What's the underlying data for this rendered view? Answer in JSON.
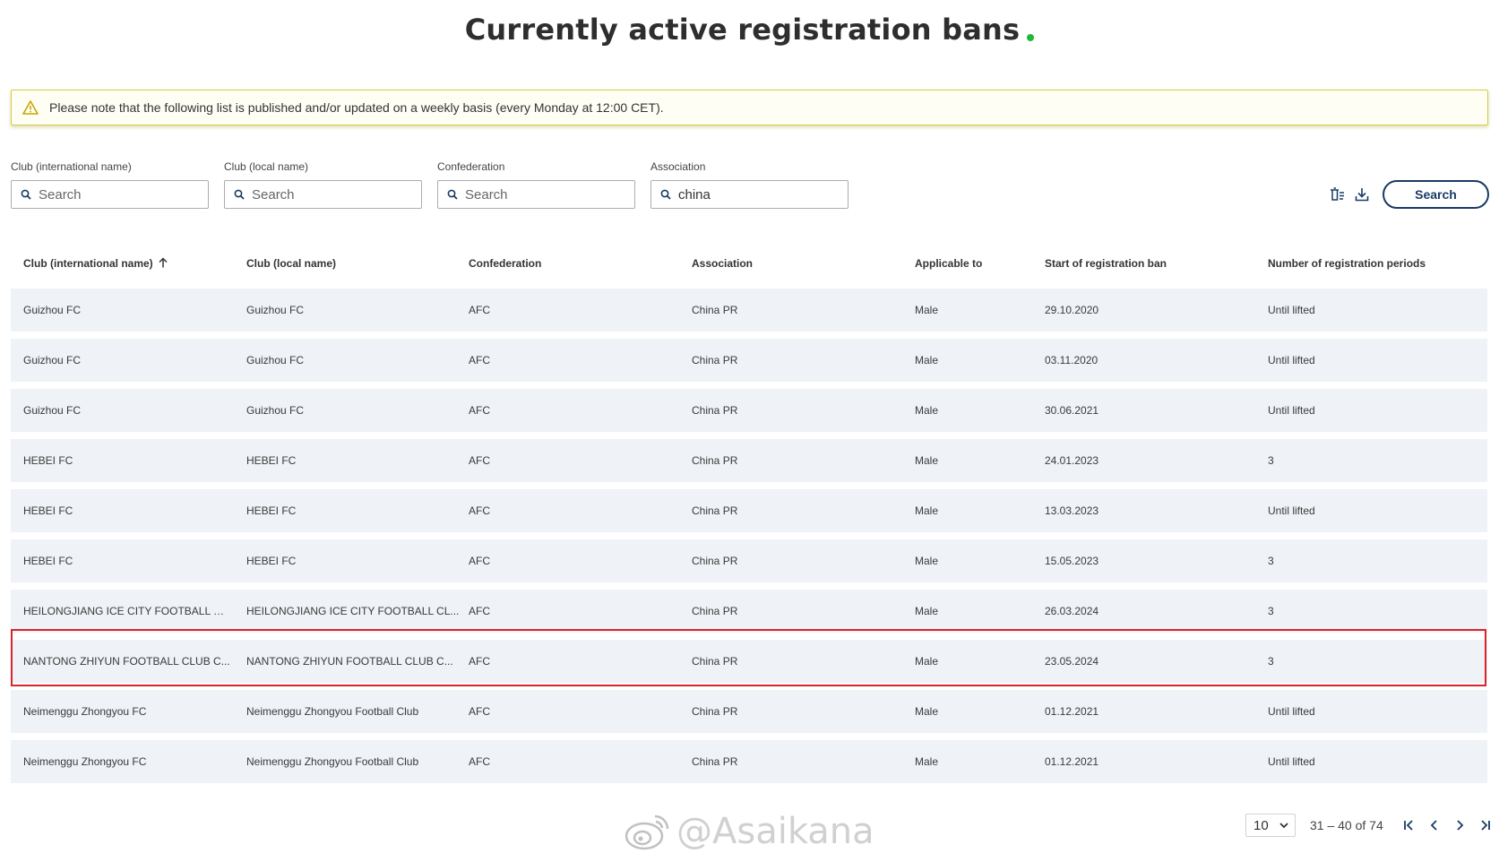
{
  "title": "Currently active registration bans",
  "notice": "Please note that the following list is published and/or updated on a weekly basis (every Monday at 12:00 CET).",
  "filters": [
    {
      "label": "Club (international name)",
      "placeholder": "Search",
      "value": ""
    },
    {
      "label": "Club (local name)",
      "placeholder": "Search",
      "value": ""
    },
    {
      "label": "Confederation",
      "placeholder": "Search",
      "value": ""
    },
    {
      "label": "Association",
      "placeholder": "Search",
      "value": "china"
    }
  ],
  "search_button": "Search",
  "columns": [
    "Club (international name)",
    "Club (local name)",
    "Confederation",
    "Association",
    "Applicable to",
    "Start of registration ban",
    "Number of registration periods"
  ],
  "rows": [
    [
      "Guizhou FC",
      "Guizhou FC",
      "AFC",
      "China PR",
      "Male",
      "29.10.2020",
      "Until lifted"
    ],
    [
      "Guizhou FC",
      "Guizhou FC",
      "AFC",
      "China PR",
      "Male",
      "03.11.2020",
      "Until lifted"
    ],
    [
      "Guizhou FC",
      "Guizhou FC",
      "AFC",
      "China PR",
      "Male",
      "30.06.2021",
      "Until lifted"
    ],
    [
      "HEBEI FC",
      "HEBEI FC",
      "AFC",
      "China PR",
      "Male",
      "24.01.2023",
      "3"
    ],
    [
      "HEBEI FC",
      "HEBEI FC",
      "AFC",
      "China PR",
      "Male",
      "13.03.2023",
      "Until lifted"
    ],
    [
      "HEBEI FC",
      "HEBEI FC",
      "AFC",
      "China PR",
      "Male",
      "15.05.2023",
      "3"
    ],
    [
      "HEILONGJIANG ICE CITY FOOTBALL CL...",
      "HEILONGJIANG ICE CITY FOOTBALL CL...",
      "AFC",
      "China PR",
      "Male",
      "26.03.2024",
      "3"
    ],
    [
      "NANTONG ZHIYUN FOOTBALL CLUB C...",
      "NANTONG ZHIYUN FOOTBALL CLUB C...",
      "AFC",
      "China PR",
      "Male",
      "23.05.2024",
      "3"
    ],
    [
      "Neimenggu Zhongyou FC",
      "Neimenggu Zhongyou Football Club",
      "AFC",
      "China PR",
      "Male",
      "01.12.2021",
      "Until lifted"
    ],
    [
      "Neimenggu Zhongyou FC",
      "Neimenggu Zhongyou Football Club",
      "AFC",
      "China PR",
      "Male",
      "01.12.2021",
      "Until lifted"
    ]
  ],
  "pagination": {
    "page_size": "10",
    "range": "31 – 40 of 74"
  },
  "watermark": "@Asaikana",
  "colors": {
    "accent": "#1a3a64",
    "row_bg": "#eff2f6",
    "highlight": "#d9242b",
    "title_dot": "#1fb83a",
    "notice_border": "#d6cc47"
  },
  "icons": [
    "warning-icon",
    "search-icon",
    "clear-filters-icon",
    "download-icon",
    "sort-asc-icon",
    "chevron-down-icon",
    "first-page-icon",
    "prev-page-icon",
    "next-page-icon",
    "last-page-icon",
    "weibo-icon"
  ]
}
